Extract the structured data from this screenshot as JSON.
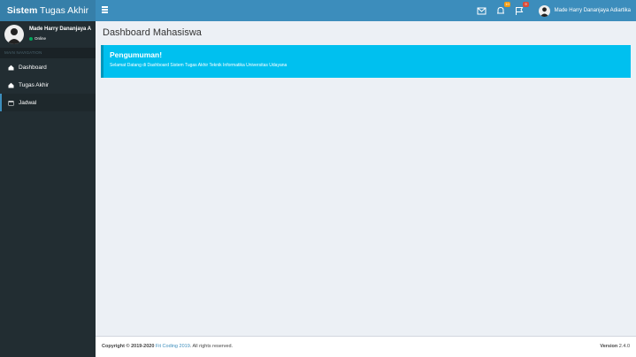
{
  "logo": {
    "bold": "Sistem",
    "rest": " Tugas Akhir"
  },
  "topbar": {
    "messages_badge": "",
    "notifications_badge": "10",
    "tasks_badge": "9",
    "user_name": "Made Harry Dananjaya Adiartika"
  },
  "sidebar": {
    "user_name": "Made Harry Dananjaya A",
    "status": "Online",
    "header": "MAIN NAVIGATION",
    "items": [
      {
        "label": "Dashboard"
      },
      {
        "label": "Tugas Akhir"
      },
      {
        "label": "Jadwal"
      }
    ]
  },
  "main": {
    "title": "Dashboard Mahasiswa",
    "announcement": {
      "heading": "Pengumuman!",
      "text": "Selamat Datang di Dashboard Sistem Tugas Akhir Teknik Informatika Universitas Udayana"
    }
  },
  "footer": {
    "copyright_prefix": "Copyright © 2019-2020",
    "link": "Fit Coding 2019",
    "suffix": ". All rights reserved.",
    "version_label": "Version",
    "version": "2.4.0"
  },
  "colors": {
    "primary": "#3c8dbc",
    "logo_bg": "#367fa9",
    "sidebar": "#222d32",
    "callout": "#00c0ef"
  }
}
